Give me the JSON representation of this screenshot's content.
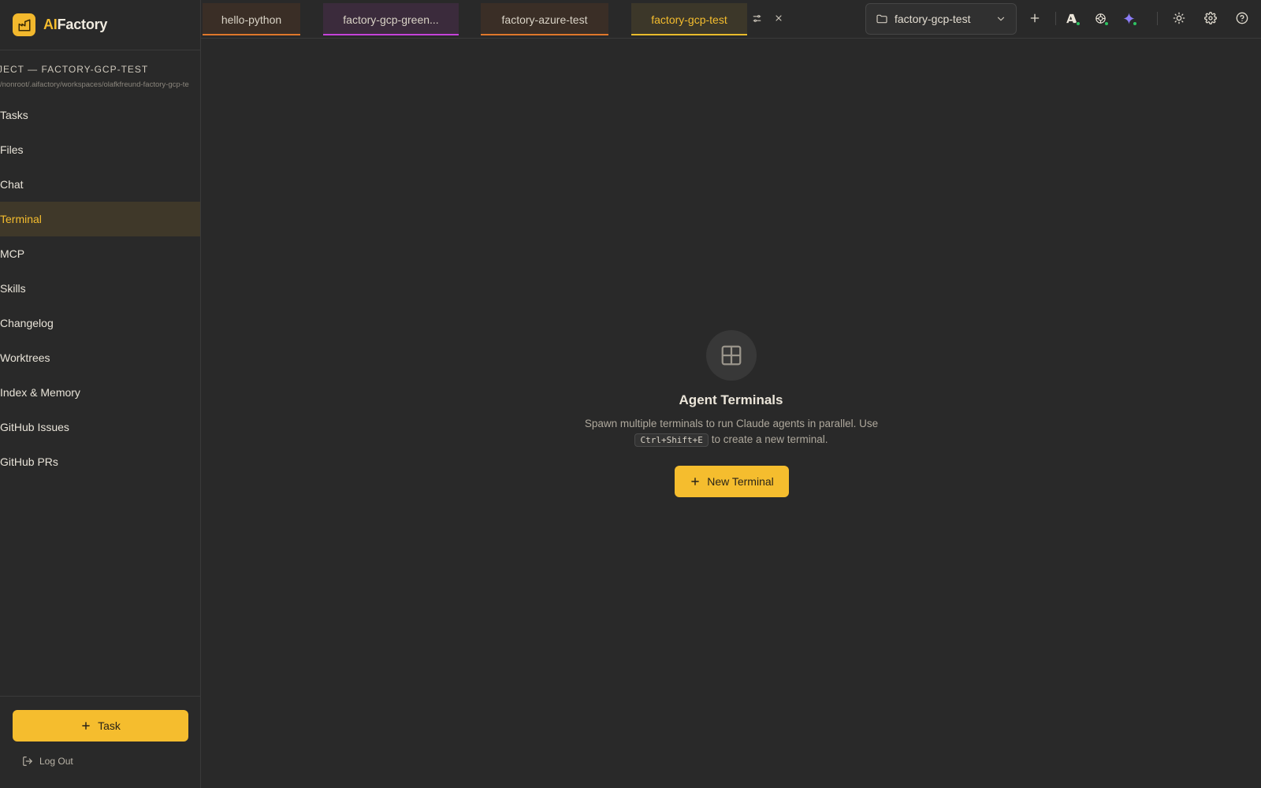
{
  "brand": {
    "prefix": "AI",
    "suffix": "Factory"
  },
  "sidebar": {
    "project_title": "JECT — FACTORY-GCP-TEST",
    "project_path": "/nonroot/.aifactory/workspaces/olafkfreund-factory-gcp-te",
    "items": [
      {
        "label": "Tasks"
      },
      {
        "label": "Files"
      },
      {
        "label": "Chat"
      },
      {
        "label": "Terminal",
        "active": true
      },
      {
        "label": "MCP"
      },
      {
        "label": "Skills"
      },
      {
        "label": "Changelog"
      },
      {
        "label": "Worktrees"
      },
      {
        "label": "Index & Memory"
      },
      {
        "label": "GitHub Issues"
      },
      {
        "label": "GitHub PRs"
      }
    ],
    "task_button": "Task",
    "logout": "Log Out"
  },
  "tabs": [
    {
      "label": "hello-python",
      "color": "#e0772b"
    },
    {
      "label": "factory-gcp-green...",
      "color": "#c542d9"
    },
    {
      "label": "factory-azure-test",
      "color": "#e0772b"
    },
    {
      "label": "factory-gcp-test",
      "color": "#e9bb2c",
      "active": true
    }
  ],
  "project_selector": {
    "value": "factory-gcp-test"
  },
  "toolbar_icons": [
    "plus-icon",
    "anthropic-icon",
    "openai-icon",
    "gemini-icon",
    "sun-icon",
    "gear-icon",
    "help-icon"
  ],
  "empty_state": {
    "title": "Agent Terminals",
    "desc_before": "Spawn multiple terminals to run Claude agents in parallel. Use",
    "shortcut": "Ctrl+Shift+E",
    "desc_after": "to create a new terminal.",
    "button": "New Terminal"
  },
  "colors": {
    "accent": "#f5bd2e",
    "background": "#292929",
    "status_green": "#2fc463"
  }
}
